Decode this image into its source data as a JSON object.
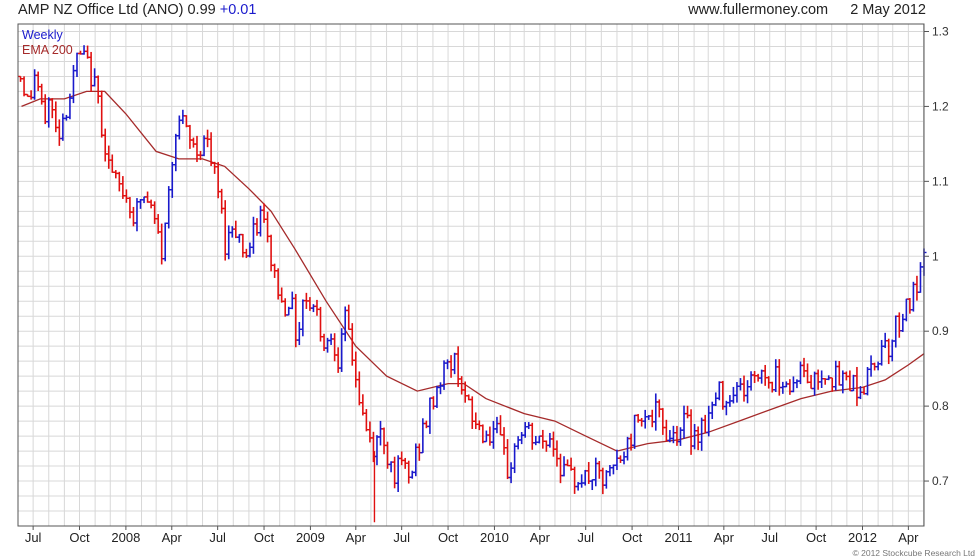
{
  "header": {
    "title": "AMP NZ Office Ltd (ANO) 0.99",
    "change": "+0.01",
    "site": "www.fullermoney.com",
    "date": "2 May 2012"
  },
  "footer": {
    "copyright": "© 2012 Stockcube Research Ltd"
  },
  "chart_data": {
    "type": "ohlc",
    "legend": [
      {
        "label": "Weekly",
        "color": "#1a1acc"
      },
      {
        "label": "EMA 200",
        "color": "#a52a2a"
      }
    ],
    "colors": {
      "up": "#1a1acc",
      "down": "#e01010",
      "ema": "#a52a2a",
      "grid": "#d8d8d8"
    },
    "ylim": [
      0.64,
      1.31
    ],
    "yticks": [
      0.7,
      0.8,
      0.9,
      1,
      1.1,
      1.2,
      1.3
    ],
    "ytick_labels": [
      "0.7",
      "0.8",
      "0.9",
      "1",
      "1.1",
      "1.2",
      "1.3"
    ],
    "xlim": [
      "2007-06-01",
      "2012-05-02"
    ],
    "xticks": [
      {
        "label": "Jul",
        "date": "2007-07-01"
      },
      {
        "label": "Oct",
        "date": "2007-10-01"
      },
      {
        "label": "2008",
        "date": "2008-01-01"
      },
      {
        "label": "Apr",
        "date": "2008-04-01"
      },
      {
        "label": "Jul",
        "date": "2008-07-01"
      },
      {
        "label": "Oct",
        "date": "2008-10-01"
      },
      {
        "label": "2009",
        "date": "2009-01-01"
      },
      {
        "label": "Apr",
        "date": "2009-04-01"
      },
      {
        "label": "Jul",
        "date": "2009-07-01"
      },
      {
        "label": "Oct",
        "date": "2009-10-01"
      },
      {
        "label": "2010",
        "date": "2010-01-01"
      },
      {
        "label": "Apr",
        "date": "2010-04-01"
      },
      {
        "label": "Jul",
        "date": "2010-07-01"
      },
      {
        "label": "Oct",
        "date": "2010-10-01"
      },
      {
        "label": "2011",
        "date": "2011-01-01"
      },
      {
        "label": "Apr",
        "date": "2011-04-01"
      },
      {
        "label": "Jul",
        "date": "2011-07-01"
      },
      {
        "label": "Oct",
        "date": "2011-10-01"
      },
      {
        "label": "2012",
        "date": "2012-01-01"
      },
      {
        "label": "Apr",
        "date": "2012-04-01"
      }
    ],
    "price_path": [
      [
        "2007-06-08",
        1.24
      ],
      [
        "2007-06-22",
        1.2
      ],
      [
        "2007-07-06",
        1.25
      ],
      [
        "2007-07-20",
        1.18
      ],
      [
        "2007-08-03",
        1.21
      ],
      [
        "2007-08-17",
        1.16
      ],
      [
        "2007-08-31",
        1.19
      ],
      [
        "2007-09-14",
        1.22
      ],
      [
        "2007-09-28",
        1.27
      ],
      [
        "2007-10-12",
        1.26
      ],
      [
        "2007-10-26",
        1.24
      ],
      [
        "2007-11-09",
        1.2
      ],
      [
        "2007-11-23",
        1.14
      ],
      [
        "2007-12-07",
        1.1
      ],
      [
        "2007-12-21",
        1.09
      ],
      [
        "2008-01-04",
        1.08
      ],
      [
        "2008-01-18",
        1.05
      ],
      [
        "2008-02-01",
        1.08
      ],
      [
        "2008-02-15",
        1.07
      ],
      [
        "2008-02-29",
        1.04
      ],
      [
        "2008-03-14",
        1.0
      ],
      [
        "2008-03-28",
        1.1
      ],
      [
        "2008-04-11",
        1.19
      ],
      [
        "2008-04-25",
        1.17
      ],
      [
        "2008-05-09",
        1.15
      ],
      [
        "2008-05-23",
        1.14
      ],
      [
        "2008-06-06",
        1.16
      ],
      [
        "2008-06-20",
        1.12
      ],
      [
        "2008-07-04",
        1.08
      ],
      [
        "2008-07-18",
        1.01
      ],
      [
        "2008-08-01",
        1.05
      ],
      [
        "2008-08-15",
        1.02
      ],
      [
        "2008-08-29",
        1.0
      ],
      [
        "2008-09-12",
        1.03
      ],
      [
        "2008-09-26",
        1.06
      ],
      [
        "2008-10-10",
        1.01
      ],
      [
        "2008-10-24",
        0.97
      ],
      [
        "2008-11-07",
        0.93
      ],
      [
        "2008-11-21",
        0.95
      ],
      [
        "2008-12-05",
        0.89
      ],
      [
        "2008-12-19",
        0.95
      ],
      [
        "2009-01-02",
        0.94
      ],
      [
        "2009-01-16",
        0.92
      ],
      [
        "2009-01-30",
        0.88
      ],
      [
        "2009-02-13",
        0.9
      ],
      [
        "2009-02-27",
        0.86
      ],
      [
        "2009-03-13",
        0.92
      ],
      [
        "2009-03-27",
        0.86
      ],
      [
        "2009-04-10",
        0.8
      ],
      [
        "2009-04-24",
        0.76
      ],
      [
        "2009-05-08",
        0.74
      ],
      [
        "2009-05-22",
        0.77
      ],
      [
        "2009-06-05",
        0.73
      ],
      [
        "2009-06-19",
        0.71
      ],
      [
        "2009-07-03",
        0.72
      ],
      [
        "2009-07-17",
        0.7
      ],
      [
        "2009-07-31",
        0.74
      ],
      [
        "2009-08-14",
        0.77
      ],
      [
        "2009-08-28",
        0.8
      ],
      [
        "2009-09-11",
        0.83
      ],
      [
        "2009-09-25",
        0.85
      ],
      [
        "2009-10-09",
        0.86
      ],
      [
        "2009-10-23",
        0.85
      ],
      [
        "2009-11-06",
        0.8
      ],
      [
        "2009-11-20",
        0.78
      ],
      [
        "2009-12-04",
        0.77
      ],
      [
        "2009-12-18",
        0.76
      ],
      [
        "2010-01-01",
        0.77
      ],
      [
        "2010-01-15",
        0.74
      ],
      [
        "2010-01-29",
        0.71
      ],
      [
        "2010-02-12",
        0.75
      ],
      [
        "2010-02-26",
        0.77
      ],
      [
        "2010-03-12",
        0.76
      ],
      [
        "2010-03-26",
        0.75
      ],
      [
        "2010-04-09",
        0.75
      ],
      [
        "2010-04-23",
        0.76
      ],
      [
        "2010-05-07",
        0.73
      ],
      [
        "2010-05-21",
        0.71
      ],
      [
        "2010-06-04",
        0.7
      ],
      [
        "2010-06-18",
        0.71
      ],
      [
        "2010-07-02",
        0.7
      ],
      [
        "2010-07-16",
        0.71
      ],
      [
        "2010-07-30",
        0.7
      ],
      [
        "2010-08-13",
        0.7
      ],
      [
        "2010-08-27",
        0.72
      ],
      [
        "2010-09-10",
        0.73
      ],
      [
        "2010-09-24",
        0.75
      ],
      [
        "2010-10-08",
        0.78
      ],
      [
        "2010-10-22",
        0.8
      ],
      [
        "2010-11-05",
        0.78
      ],
      [
        "2010-11-19",
        0.79
      ],
      [
        "2010-12-03",
        0.77
      ],
      [
        "2010-12-17",
        0.76
      ],
      [
        "2010-12-31",
        0.77
      ],
      [
        "2011-01-14",
        0.78
      ],
      [
        "2011-01-28",
        0.76
      ],
      [
        "2011-02-11",
        0.77
      ],
      [
        "2011-02-25",
        0.78
      ],
      [
        "2011-03-11",
        0.8
      ],
      [
        "2011-03-25",
        0.82
      ],
      [
        "2011-04-08",
        0.81
      ],
      [
        "2011-04-22",
        0.83
      ],
      [
        "2011-05-06",
        0.82
      ],
      [
        "2011-05-20",
        0.83
      ],
      [
        "2011-06-03",
        0.84
      ],
      [
        "2011-06-17",
        0.85
      ],
      [
        "2011-07-01",
        0.83
      ],
      [
        "2011-07-15",
        0.84
      ],
      [
        "2011-07-29",
        0.84
      ],
      [
        "2011-08-12",
        0.82
      ],
      [
        "2011-08-26",
        0.85
      ],
      [
        "2011-09-09",
        0.84
      ],
      [
        "2011-09-23",
        0.83
      ],
      [
        "2011-10-07",
        0.84
      ],
      [
        "2011-10-21",
        0.85
      ],
      [
        "2011-11-04",
        0.84
      ],
      [
        "2011-11-18",
        0.83
      ],
      [
        "2011-12-02",
        0.84
      ],
      [
        "2011-12-16",
        0.83
      ],
      [
        "2011-12-30",
        0.82
      ],
      [
        "2012-01-13",
        0.84
      ],
      [
        "2012-01-27",
        0.86
      ],
      [
        "2012-02-10",
        0.89
      ],
      [
        "2012-02-24",
        0.88
      ],
      [
        "2012-03-09",
        0.91
      ],
      [
        "2012-03-23",
        0.93
      ],
      [
        "2012-04-06",
        0.94
      ],
      [
        "2012-04-20",
        0.96
      ],
      [
        "2012-05-02",
        0.99
      ]
    ],
    "ema_path": [
      [
        "2007-06-08",
        1.2
      ],
      [
        "2007-07-15",
        1.21
      ],
      [
        "2007-09-01",
        1.21
      ],
      [
        "2007-10-15",
        1.22
      ],
      [
        "2007-11-20",
        1.22
      ],
      [
        "2008-01-01",
        1.19
      ],
      [
        "2008-03-01",
        1.14
      ],
      [
        "2008-04-15",
        1.13
      ],
      [
        "2008-06-01",
        1.13
      ],
      [
        "2008-07-15",
        1.12
      ],
      [
        "2008-09-01",
        1.09
      ],
      [
        "2008-10-15",
        1.06
      ],
      [
        "2008-12-01",
        1.01
      ],
      [
        "2009-02-01",
        0.94
      ],
      [
        "2009-04-01",
        0.88
      ],
      [
        "2009-06-01",
        0.84
      ],
      [
        "2009-08-01",
        0.82
      ],
      [
        "2009-10-01",
        0.83
      ],
      [
        "2009-11-01",
        0.83
      ],
      [
        "2009-12-15",
        0.81
      ],
      [
        "2010-03-01",
        0.79
      ],
      [
        "2010-05-01",
        0.78
      ],
      [
        "2010-07-01",
        0.76
      ],
      [
        "2010-09-01",
        0.74
      ],
      [
        "2010-11-01",
        0.75
      ],
      [
        "2011-01-01",
        0.755
      ],
      [
        "2011-03-01",
        0.765
      ],
      [
        "2011-05-01",
        0.78
      ],
      [
        "2011-07-01",
        0.795
      ],
      [
        "2011-09-01",
        0.81
      ],
      [
        "2011-11-01",
        0.82
      ],
      [
        "2012-01-01",
        0.825
      ],
      [
        "2012-02-15",
        0.835
      ],
      [
        "2012-04-01",
        0.855
      ],
      [
        "2012-05-02",
        0.87
      ]
    ],
    "low_spikes": [
      {
        "date": "2009-05-08",
        "low": 0.645
      }
    ]
  }
}
